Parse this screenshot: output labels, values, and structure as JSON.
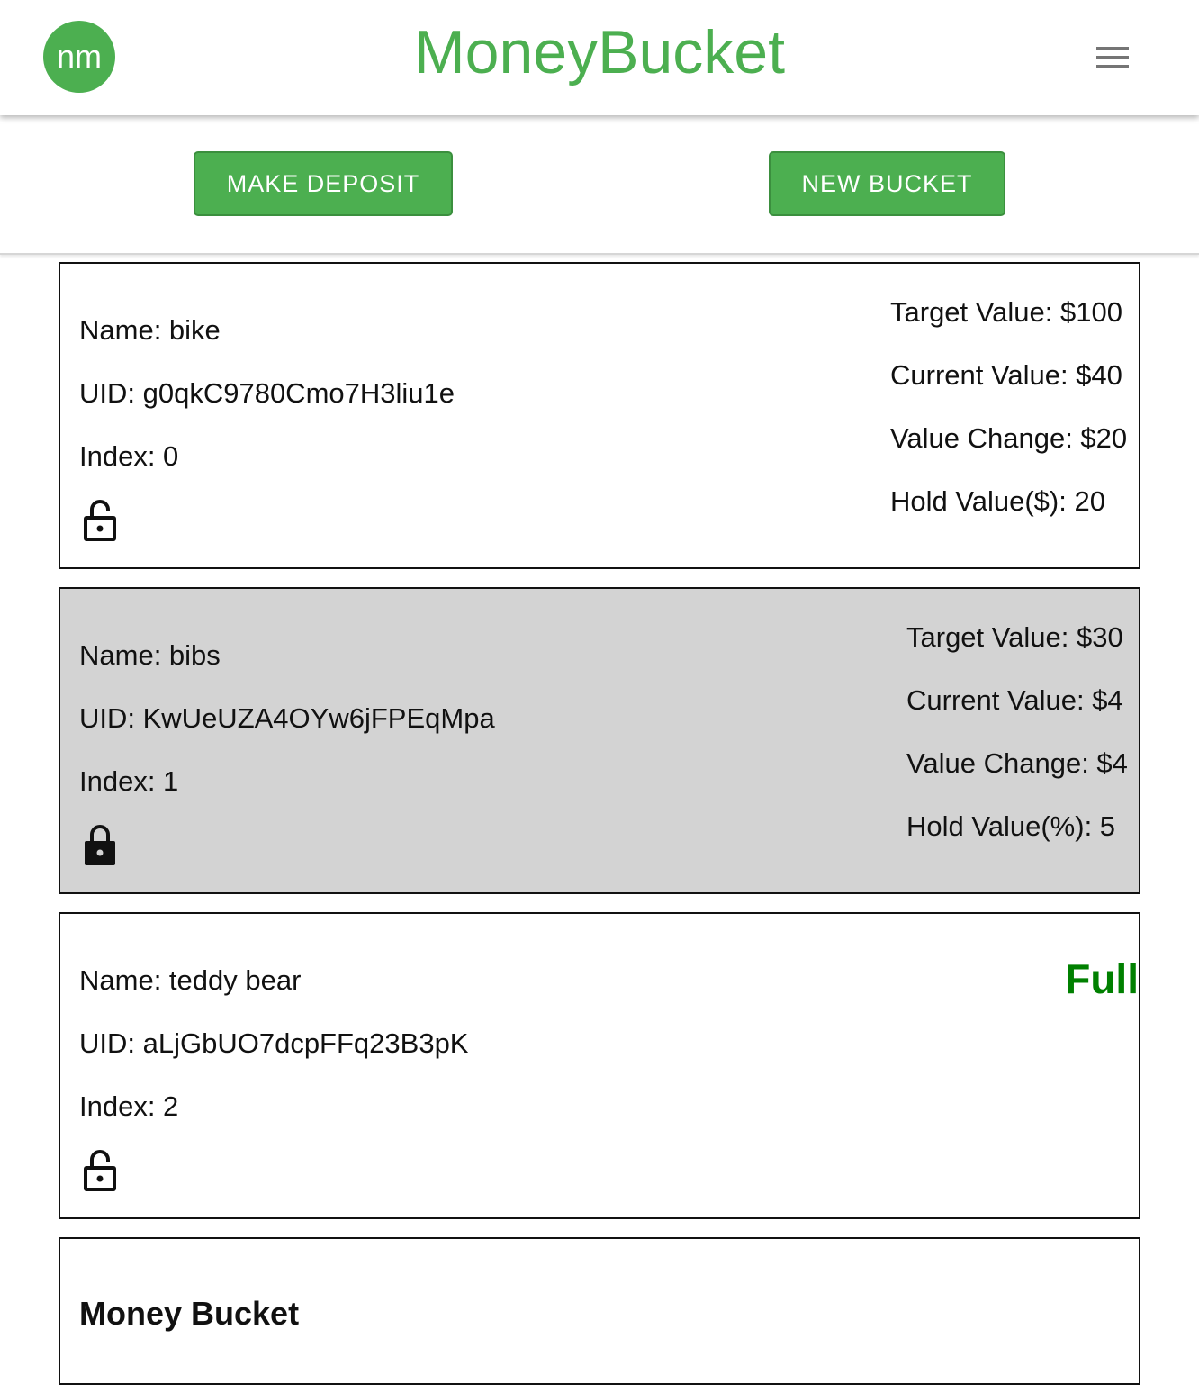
{
  "header": {
    "avatar_initials": "nm",
    "title": "MoneyBucket",
    "menu_icon": "hamburger-menu-icon"
  },
  "toolbar": {
    "deposit_label": "MAKE DEPOSIT",
    "new_bucket_label": "NEW BUCKET"
  },
  "colors": {
    "brand": "#4caf50",
    "full": "#008000",
    "selected_card": "#d3d3d3"
  },
  "buckets": [
    {
      "name": "Name: bike",
      "uid": "UID: g0qkC9780Cmo7H3liu1e",
      "index": "Index: 0",
      "lock_icon": "unlocked-padlock-icon",
      "target": "Target Value: $100",
      "current": "Current Value: $40",
      "change": "Value Change: $20",
      "hold": "Hold Value($): 20"
    },
    {
      "name": "Name: bibs",
      "uid": "UID: KwUeUZA4OYw6jFPEqMpa",
      "index": "Index: 1",
      "lock_icon": "locked-padlock-icon",
      "target": "Target Value: $30",
      "current": "Current Value: $4",
      "change": "Value Change: $4",
      "hold": "Hold Value(%): 5"
    },
    {
      "name": "Name: teddy bear",
      "uid": "UID: aLjGbUO7dcpFFq23B3pK",
      "index": "Index: 2",
      "lock_icon": "unlocked-padlock-icon",
      "status": "Full"
    }
  ],
  "footer": {
    "title": "Money Bucket"
  }
}
